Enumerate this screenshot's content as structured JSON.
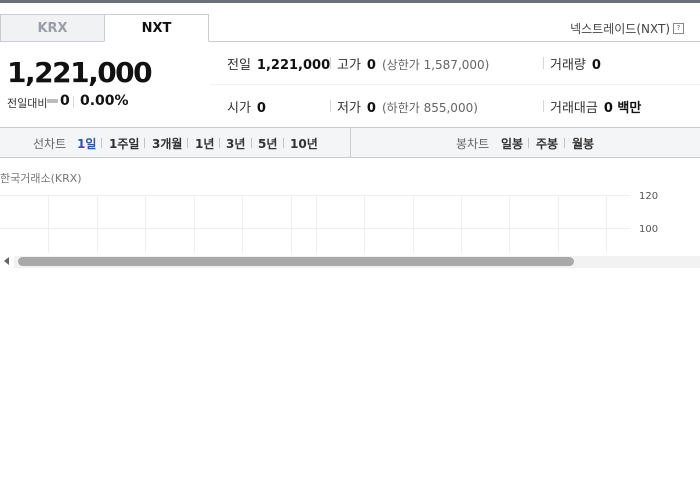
{
  "tabs": [
    {
      "label": "KRX",
      "active": false
    },
    {
      "label": "NXT",
      "active": true
    }
  ],
  "nxt_link": {
    "label": "넥스트레이드(NXT)",
    "help_icon": "question-icon"
  },
  "price": {
    "current": "1,221,000",
    "change_label": "전일대비",
    "change_value": "0",
    "change_rate": "0.00%"
  },
  "stats": {
    "prev_close_label": "전일",
    "prev_close_value": "1,221,000",
    "high_label": "고가",
    "high_value": "0",
    "upper_limit": "(상한가 1,587,000)",
    "volume_label": "거래량",
    "volume_value": "0",
    "open_label": "시가",
    "open_value": "0",
    "low_label": "저가",
    "low_value": "0",
    "lower_limit": "(하한가 855,000)",
    "amount_label": "거래대금",
    "amount_value": "0 백만"
  },
  "toolbar": {
    "line_chart_label": "선차트",
    "periods": [
      "1일",
      "1주일",
      "3개월",
      "1년",
      "3년",
      "5년",
      "10년"
    ],
    "active_period": "1일",
    "candle_label": "봉차트",
    "candles": [
      "일봉",
      "주봉",
      "월봉"
    ]
  },
  "chart": {
    "exchange_title": "한국거래소(KRX)",
    "y_ticks": [
      "120",
      "100"
    ]
  },
  "colors": {
    "active_tab_text": "#111111",
    "active_period": "#2a54b3",
    "border": "#c9cdd3"
  }
}
